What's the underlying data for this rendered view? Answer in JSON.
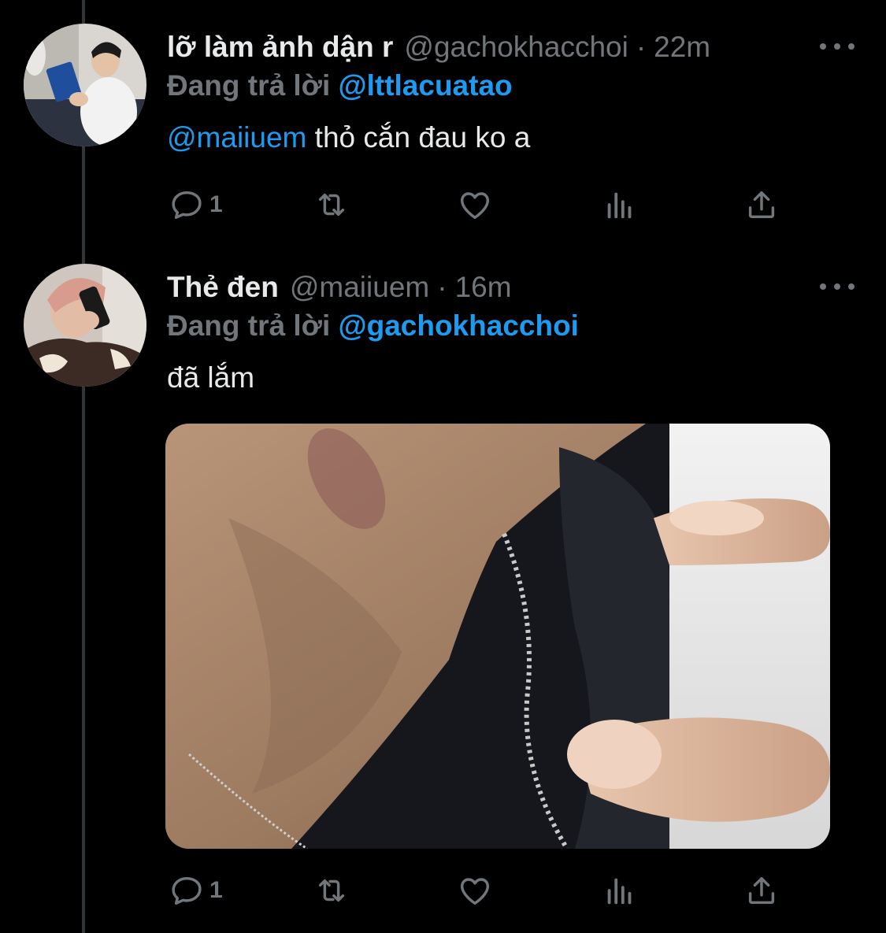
{
  "tweets": [
    {
      "name": "lỡ làm ảnh dận r",
      "handle": "@gachokhacchoi",
      "separator": "·",
      "time": "22m",
      "replying_prefix": "Đang trả lời",
      "replying_to": "@lttlacuatao",
      "text_mention": "@maiiuem",
      "text": "thỏ cắn đau ko a",
      "reply_count": "1"
    },
    {
      "name": "Thẻ đen",
      "handle": "@maiiuem",
      "separator": "·",
      "time": "16m",
      "replying_prefix": "Đang trả lời",
      "replying_to": "@gachokhacchoi",
      "text": "đã lắm",
      "reply_count": "1"
    }
  ],
  "colors": {
    "background": "#000000",
    "text": "#e7e9ea",
    "muted": "#71767b",
    "accent": "#1d9bf0",
    "thread_line": "#333639"
  },
  "icons": [
    "reply-icon",
    "retweet-icon",
    "like-icon",
    "analytics-icon",
    "share-icon",
    "more-icon"
  ]
}
